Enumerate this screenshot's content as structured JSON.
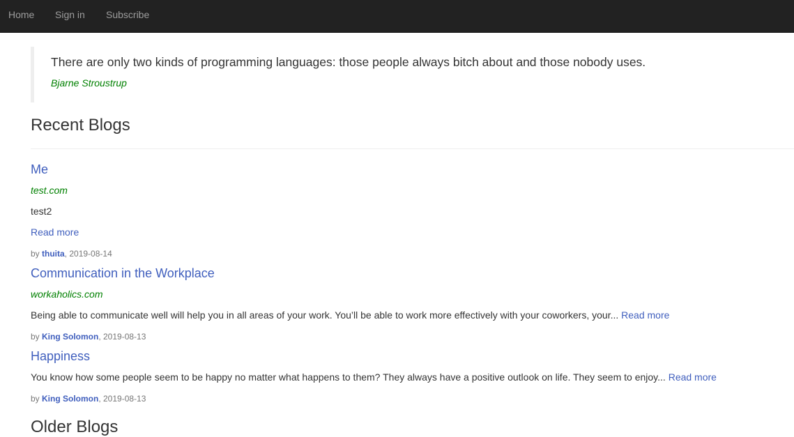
{
  "nav": {
    "home": "Home",
    "sign_in": "Sign in",
    "subscribe": "Subscribe"
  },
  "quote": {
    "text": "There are only two kinds of programming languages: those people always bitch about and those nobody uses.",
    "author": "Bjarne Stroustrup"
  },
  "sections": {
    "recent": "Recent Blogs",
    "older": "Older Blogs"
  },
  "posts": [
    {
      "title": "Me",
      "source": "test.com",
      "body": "test2",
      "read_more": "Read more",
      "by": "by ",
      "author": "thuita",
      "date": ", 2019-08-14"
    },
    {
      "title": "Communication in the Workplace",
      "source": "workaholics.com",
      "body": "Being able to communicate well will help you in all areas of your work. You’ll be able to work more effectively with your coworkers, your... ",
      "read_more": "Read more",
      "by": "by ",
      "author": "King Solomon",
      "date": ", 2019-08-13"
    },
    {
      "title": "Happiness",
      "body": "You know how some people seem to be happy no matter what happens to them? They always have a positive outlook on life. They seem to enjoy... ",
      "read_more": "Read more",
      "by": "by ",
      "author": "King Solomon",
      "date": ", 2019-08-13"
    }
  ],
  "colors": {
    "navbar_bg": "#222222",
    "link": "#3f5ebd",
    "source_green": "#008000",
    "muted": "#777777"
  }
}
